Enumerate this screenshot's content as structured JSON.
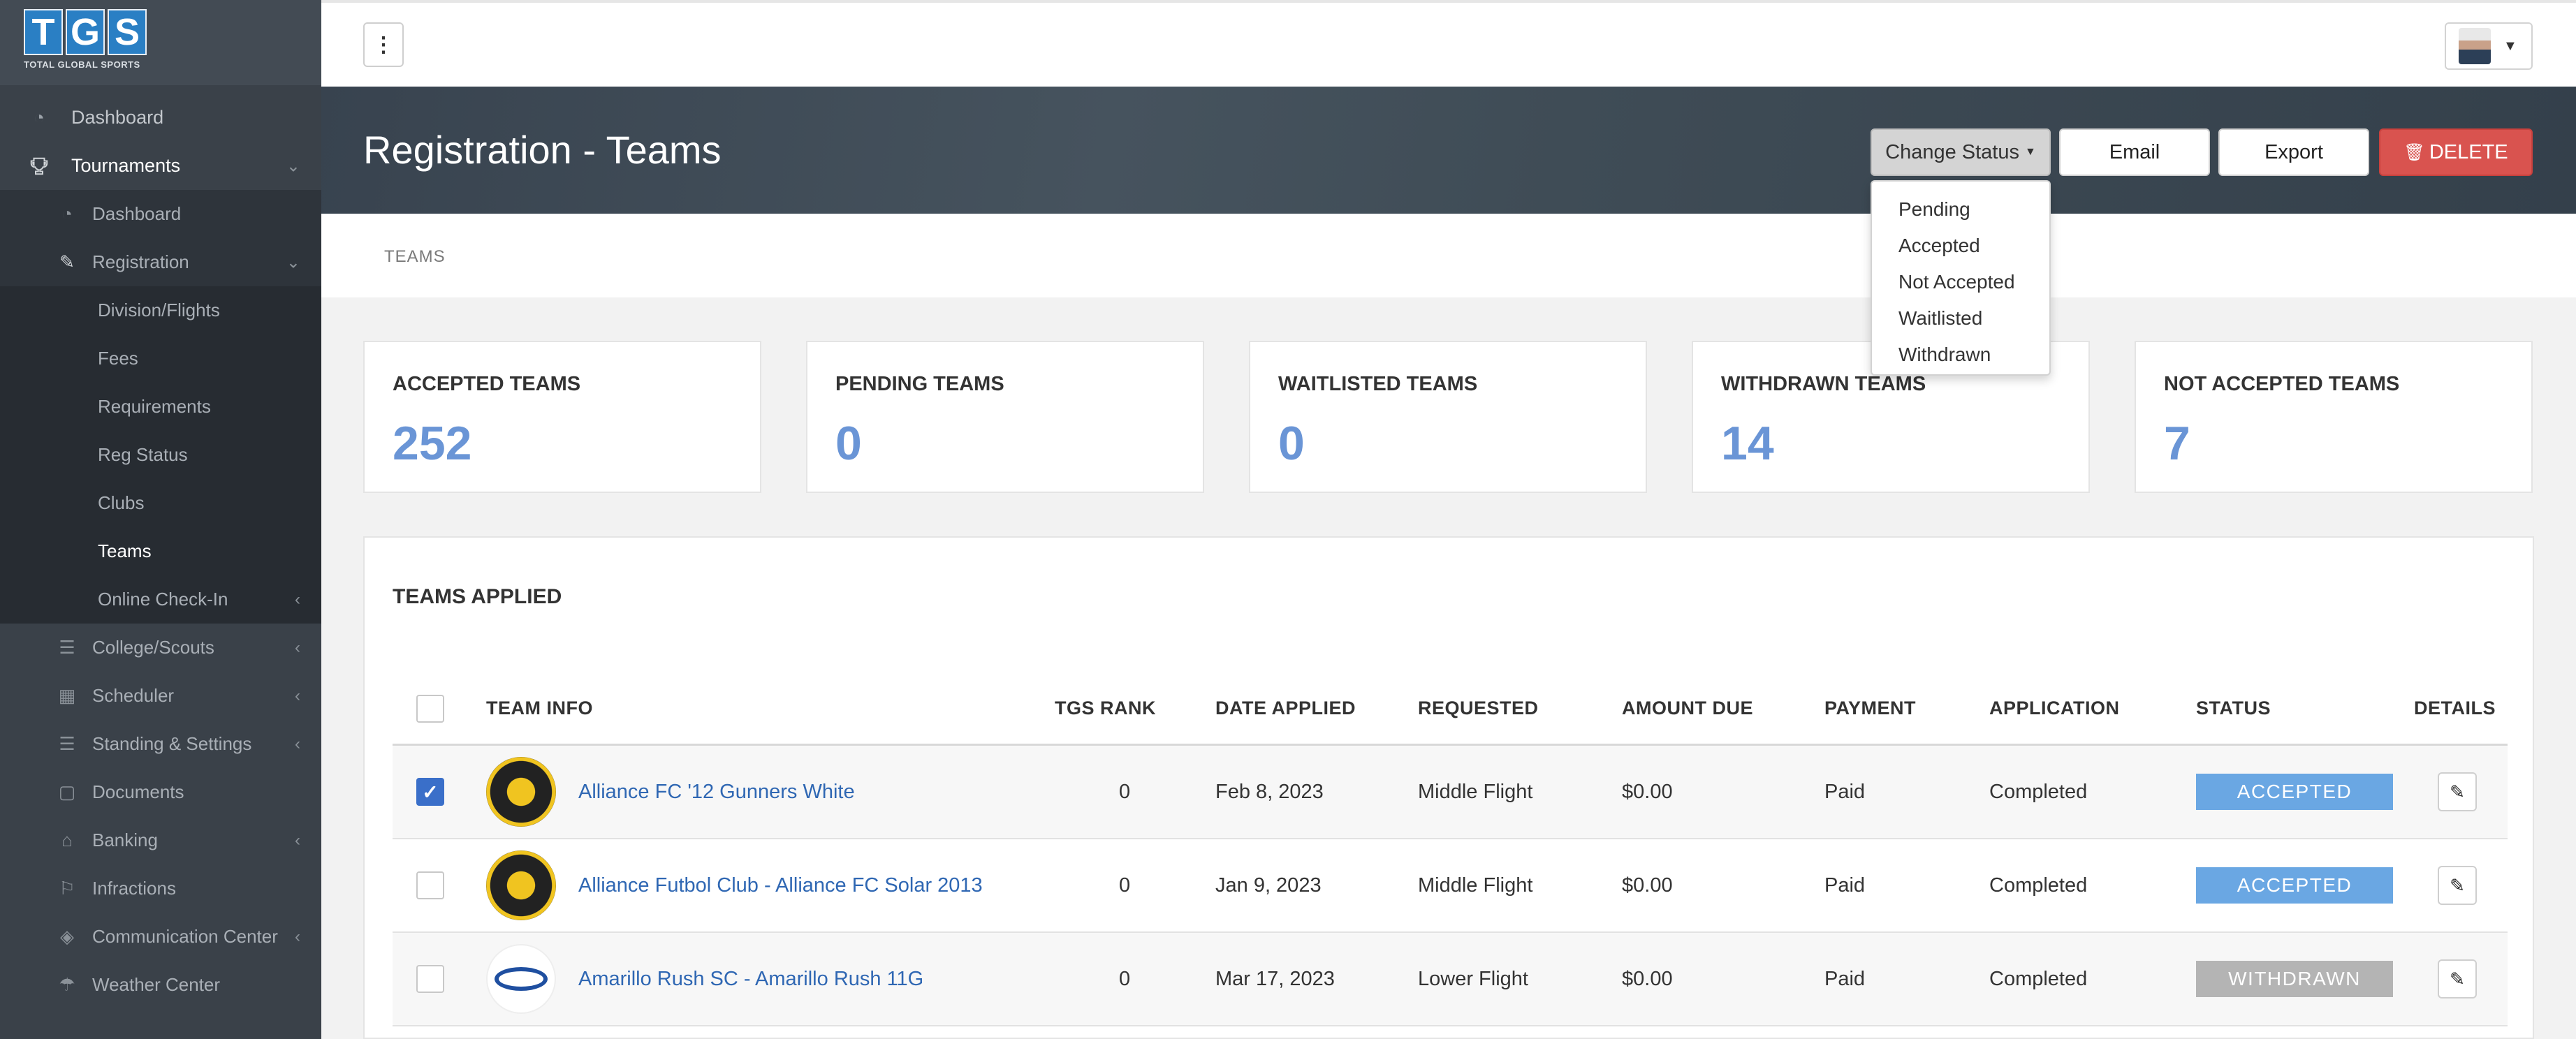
{
  "sidebar": {
    "logo": {
      "letters": [
        "T",
        "G",
        "S"
      ],
      "tagline": "TOTAL GLOBAL SPORTS"
    },
    "top_items": [
      {
        "label": "Dashboard",
        "icon": "dashboard-gauge-icon"
      },
      {
        "label": "Tournaments",
        "icon": "trophy-icon"
      }
    ],
    "tournament_items": [
      {
        "label": "Dashboard"
      },
      {
        "label": "Registration"
      }
    ],
    "registration_items": [
      {
        "label": "Division/Flights"
      },
      {
        "label": "Fees"
      },
      {
        "label": "Requirements"
      },
      {
        "label": "Reg Status"
      },
      {
        "label": "Clubs"
      },
      {
        "label": "Teams"
      },
      {
        "label": "Online Check-In"
      }
    ],
    "other_items": [
      {
        "label": "College/Scouts"
      },
      {
        "label": "Scheduler"
      },
      {
        "label": "Standing & Settings"
      },
      {
        "label": "Documents"
      },
      {
        "label": "Banking"
      },
      {
        "label": "Infractions"
      },
      {
        "label": "Communication Center"
      },
      {
        "label": "Weather Center"
      }
    ]
  },
  "header": {
    "title": "Registration - Teams",
    "change_status_label": "Change Status",
    "email_label": "Email",
    "export_label": "Export",
    "delete_label": "DELETE"
  },
  "status_menu": {
    "options": [
      "Pending",
      "Accepted",
      "Not Accepted",
      "Waitlisted",
      "Withdrawn"
    ]
  },
  "breadcrumb": "TEAMS",
  "stats": [
    {
      "label": "ACCEPTED TEAMS",
      "value": "252"
    },
    {
      "label": "PENDING TEAMS",
      "value": "0"
    },
    {
      "label": "WAITLISTED TEAMS",
      "value": "0"
    },
    {
      "label": "WITHDRAWN TEAMS",
      "value": "14"
    },
    {
      "label": "NOT ACCEPTED TEAMS",
      "value": "7"
    }
  ],
  "teams_table": {
    "title": "TEAMS APPLIED",
    "columns": [
      "TEAM INFO",
      "TGS RANK",
      "DATE APPLIED",
      "REQUESTED",
      "AMOUNT DUE",
      "PAYMENT",
      "APPLICATION",
      "STATUS",
      "DETAILS"
    ],
    "rows": [
      {
        "team": "Alliance FC '12 Gunners White",
        "rank": "0",
        "date": "Feb 8, 2023",
        "requested": "Middle Flight",
        "amount": "$0.00",
        "payment": "Paid",
        "application": "Completed",
        "status": "ACCEPTED",
        "checked": true
      },
      {
        "team": "Alliance Futbol Club - Alliance FC Solar 2013",
        "rank": "0",
        "date": "Jan 9, 2023",
        "requested": "Middle Flight",
        "amount": "$0.00",
        "payment": "Paid",
        "application": "Completed",
        "status": "ACCEPTED",
        "checked": false
      },
      {
        "team": "Amarillo Rush SC - Amarillo Rush 11G",
        "rank": "0",
        "date": "Mar 17, 2023",
        "requested": "Lower Flight",
        "amount": "$0.00",
        "payment": "Paid",
        "application": "Completed",
        "status": "WITHDRAWN",
        "checked": false
      }
    ]
  },
  "colors": {
    "accepted": "#6aa7e3",
    "withdrawn": "#b4b4b4",
    "stat_value": "#6a95d6",
    "delete": "#d9534f",
    "link": "#2f67b3"
  }
}
